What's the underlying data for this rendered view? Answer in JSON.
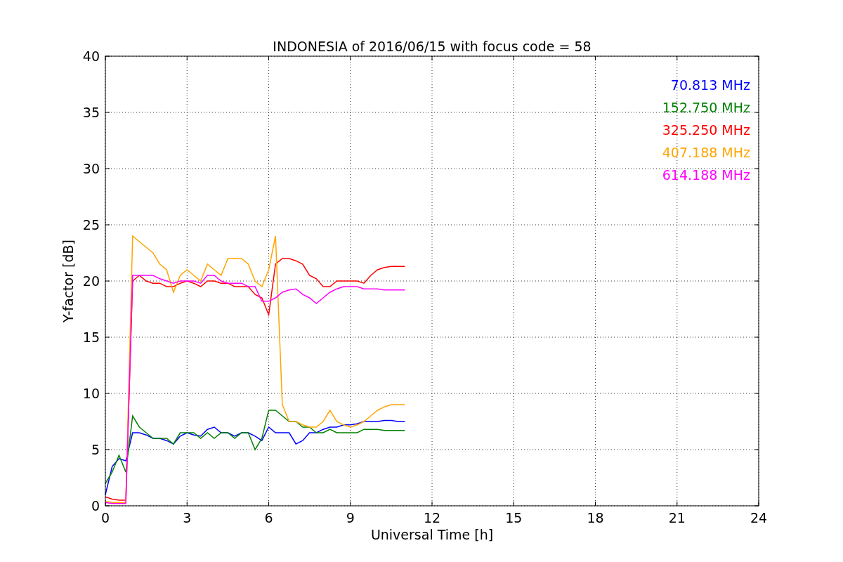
{
  "figure": {
    "chart_data": {
      "type": "line",
      "title": "INDONESIA of 2016/06/15 with focus code = 58",
      "xlabel": "Universal Time [h]",
      "ylabel": "Y-factor [dB]",
      "x": [
        0,
        0.25,
        0.5,
        0.75,
        1,
        1.25,
        1.5,
        1.75,
        2,
        2.25,
        2.5,
        2.75,
        3,
        3.25,
        3.5,
        3.75,
        4,
        4.25,
        4.5,
        4.75,
        5,
        5.25,
        5.5,
        5.75,
        6,
        6.25,
        6.5,
        6.75,
        7,
        7.25,
        7.5,
        7.75,
        8,
        8.25,
        8.5,
        8.75,
        9,
        9.25,
        9.5,
        9.75,
        10,
        10.25,
        10.5,
        10.75,
        11
      ],
      "series": [
        {
          "name": "70.813 MHz",
          "color": "#0000ff",
          "values": [
            1,
            3.5,
            4.2,
            4,
            6.5,
            6.5,
            6.3,
            6,
            6,
            5.8,
            5.5,
            6.2,
            6.5,
            6.3,
            6.2,
            6.8,
            7,
            6.5,
            6.5,
            6.2,
            6.5,
            6.5,
            6.2,
            5.8,
            7,
            6.5,
            6.5,
            6.5,
            5.5,
            5.8,
            6.5,
            6.5,
            6.8,
            7,
            7,
            7.2,
            7.2,
            7.3,
            7.5,
            7.5,
            7.5,
            7.6,
            7.6,
            7.5,
            7.5
          ]
        },
        {
          "name": "152.750 MHz",
          "color": "#008000",
          "values": [
            2,
            3,
            4.5,
            3,
            8,
            7,
            6.5,
            6,
            6,
            6,
            5.5,
            6.5,
            6.5,
            6.5,
            6,
            6.5,
            6,
            6.5,
            6.5,
            6,
            6.5,
            6.5,
            5,
            6,
            8.5,
            8.5,
            8,
            7.5,
            7.5,
            7,
            7,
            6.5,
            6.5,
            6.8,
            6.5,
            6.5,
            6.5,
            6.5,
            6.8,
            6.8,
            6.8,
            6.7,
            6.7,
            6.7,
            6.7
          ]
        },
        {
          "name": "325.250 MHz",
          "color": "#ff0000",
          "values": [
            0.8,
            0.6,
            0.5,
            0.5,
            20,
            20.5,
            20,
            19.8,
            19.8,
            19.5,
            19.5,
            19.8,
            20,
            19.8,
            19.5,
            20,
            20,
            19.8,
            19.8,
            19.5,
            19.5,
            19.5,
            18.8,
            18.5,
            17,
            21.5,
            22,
            22,
            21.8,
            21.5,
            20.5,
            20.2,
            19.5,
            19.5,
            20,
            20,
            20,
            20,
            19.8,
            20.5,
            21,
            21.2,
            21.3,
            21.3,
            21.3
          ]
        },
        {
          "name": "407.188 MHz",
          "color": "#ffa500",
          "values": [
            0.4,
            0.3,
            0.3,
            0.3,
            24,
            23.5,
            23,
            22.5,
            21.5,
            21,
            19,
            20.5,
            21,
            20.5,
            20,
            21.5,
            21,
            20.5,
            22,
            22,
            22,
            21.5,
            20,
            19.5,
            21,
            24,
            9,
            7.5,
            7.5,
            7.2,
            7,
            7,
            7.5,
            8.5,
            7.5,
            7.2,
            7,
            7.2,
            7.5,
            8,
            8.5,
            8.8,
            9,
            9,
            9
          ]
        },
        {
          "name": "614.188 MHz",
          "color": "#ff00ff",
          "values": [
            0.3,
            0.2,
            0.2,
            0.2,
            20.5,
            20.5,
            20.5,
            20.5,
            20.2,
            20,
            19.8,
            20,
            20,
            20,
            19.8,
            20.5,
            20.5,
            20,
            19.8,
            19.8,
            19.8,
            19.5,
            19.5,
            18.2,
            18.2,
            18.5,
            19,
            19.2,
            19.3,
            18.8,
            18.5,
            18,
            18.5,
            19,
            19.3,
            19.5,
            19.5,
            19.5,
            19.3,
            19.3,
            19.3,
            19.2,
            19.2,
            19.2,
            19.2
          ]
        }
      ],
      "grid": true,
      "xlim": [
        0,
        24
      ],
      "ylim": [
        0,
        40
      ],
      "xticks": [
        0,
        3,
        6,
        9,
        12,
        15,
        18,
        21,
        24
      ],
      "yticks": [
        0,
        5,
        10,
        15,
        20,
        25,
        30,
        35,
        40
      ]
    }
  }
}
